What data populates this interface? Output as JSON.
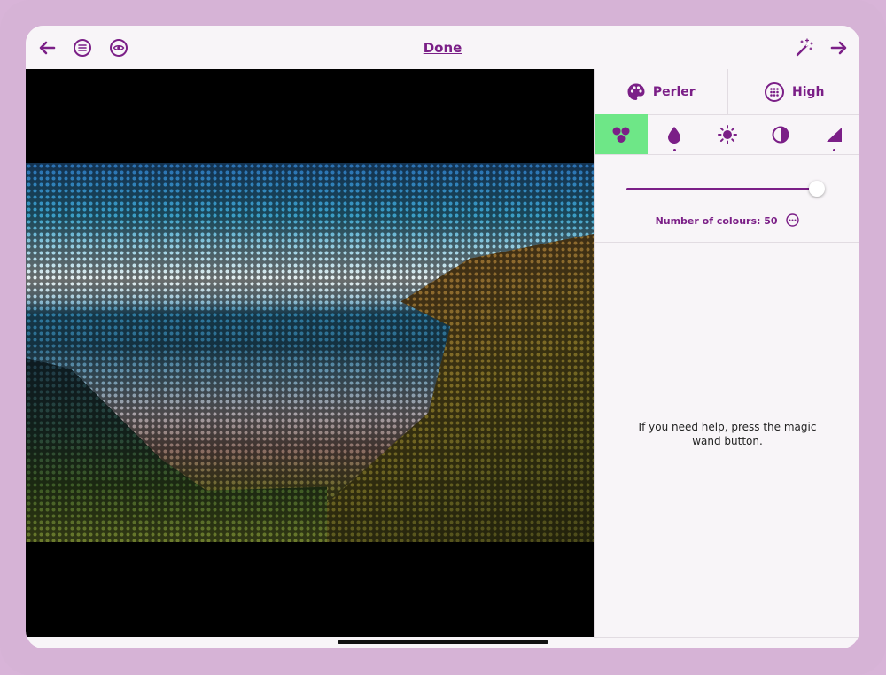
{
  "header": {
    "title": "Done",
    "icons": {
      "back": "arrow-left-icon",
      "menu": "menu-circle-icon",
      "preview": "eye-circle-icon",
      "magic": "magic-wand-icon",
      "next": "arrow-right-icon"
    }
  },
  "panel": {
    "palette_label": "Perler",
    "quality_label": "High",
    "tools": [
      "colours-icon",
      "drop-icon",
      "brightness-icon",
      "contrast-icon",
      "gradient-icon"
    ],
    "active_tool": 0,
    "slider": {
      "label": "Number of colours: 50",
      "value": 50
    },
    "help_text": "If you need help, press the magic wand button."
  },
  "colors": {
    "accent": "#7b1f87",
    "active_tool_bg": "#6ee787",
    "frame": "#d6b3d6"
  }
}
